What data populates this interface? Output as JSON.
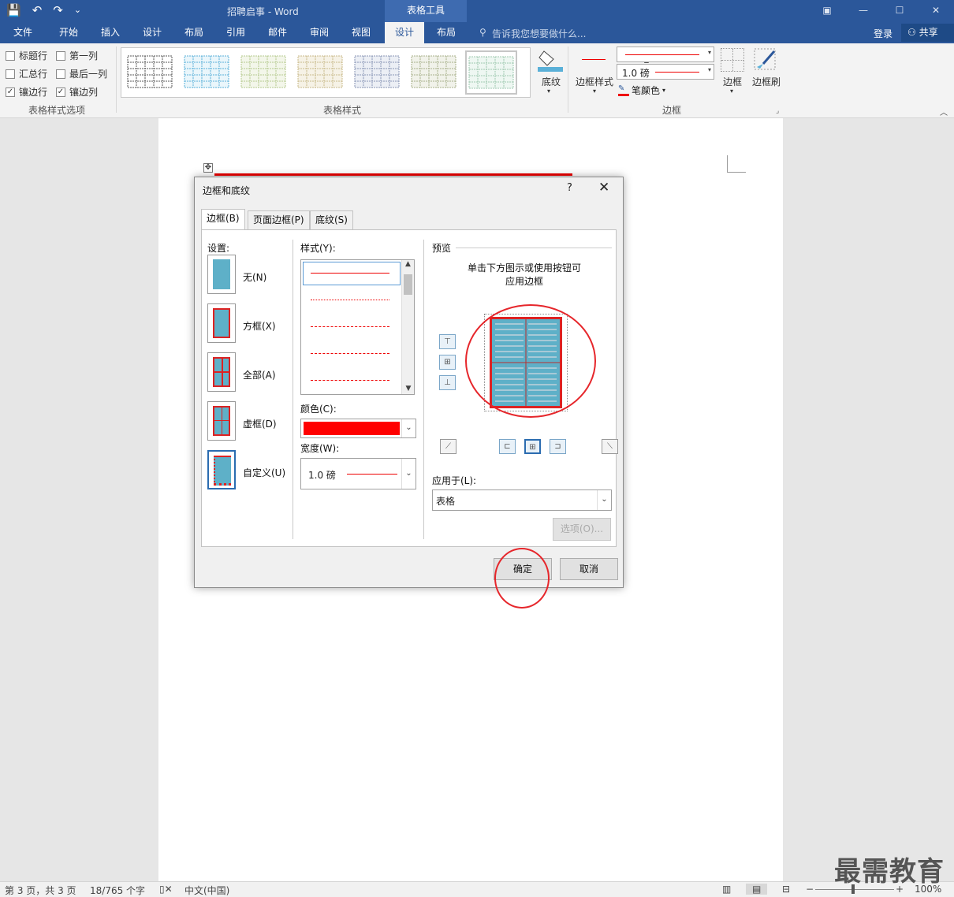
{
  "titlebar": {
    "title": "招聘启事 - Word",
    "context_tab": "表格工具",
    "save_icon": "💾",
    "undo_icon": "↶",
    "redo_icon": "↷",
    "customize_icon": "⌄",
    "restore_icon": "▣",
    "minimize_icon": "—",
    "maximize_icon": "☐",
    "close_icon": "✕"
  },
  "tabs": {
    "file": "文件",
    "home": "开始",
    "insert": "插入",
    "design": "设计",
    "layout": "布局",
    "references": "引用",
    "mailings": "邮件",
    "review": "审阅",
    "view": "视图",
    "table_design": "设计",
    "table_layout": "布局",
    "tell_me": "告诉我您想要做什么...",
    "login": "登录",
    "share": "共享"
  },
  "ribbon": {
    "options": {
      "header_row": "标题行",
      "first_column": "第一列",
      "total_row": "汇总行",
      "last_column": "最后一列",
      "banded_rows": "镶边行",
      "banded_columns": "镶边列",
      "header_row_checked": false,
      "first_column_checked": false,
      "total_row_checked": false,
      "last_column_checked": false,
      "banded_rows_checked": true,
      "banded_columns_checked": true,
      "group_label": "表格样式选项"
    },
    "styles_group_label": "表格样式",
    "shading_label": "底纹",
    "border_styles_label": "边框样式",
    "pen_weight": "1.0 磅",
    "pen_color_label": "笔颜色",
    "borders_label": "边框",
    "border_painter_label": "边框刷",
    "borders_group_label": "边框",
    "table_style_colors": [
      "#5a5a5a",
      "#5ab0d8",
      "#b5c98e",
      "#c8b98a",
      "#8896b5",
      "#a8b08a",
      "#9fc9b0"
    ]
  },
  "dialog": {
    "title": "边框和底纹",
    "help": "?",
    "close": "✕",
    "tabs": {
      "borders": "边框(B)",
      "page_border": "页面边框(P)",
      "shading": "底纹(S)"
    },
    "settings_label": "设置:",
    "settings": {
      "none": "无(N)",
      "box": "方框(X)",
      "all": "全部(A)",
      "grid": "虚框(D)",
      "custom": "自定义(U)"
    },
    "style_label": "样式(Y):",
    "color_label": "颜色(C):",
    "color_value": "#ff0000",
    "width_label": "宽度(W):",
    "width_value": "1.0 磅",
    "preview_label": "预览",
    "preview_hint_1": "单击下方图示或使用按钮可",
    "preview_hint_2": "应用边框",
    "apply_to_label": "应用于(L):",
    "apply_to_value": "表格",
    "options_button": "选项(O)...",
    "ok_button": "确定",
    "cancel_button": "取消"
  },
  "status": {
    "page": "第 3 页，共 3 页",
    "words": "18/765 个字",
    "language": "中文(中国)",
    "zoom": "100%"
  },
  "watermark": "最需教育"
}
